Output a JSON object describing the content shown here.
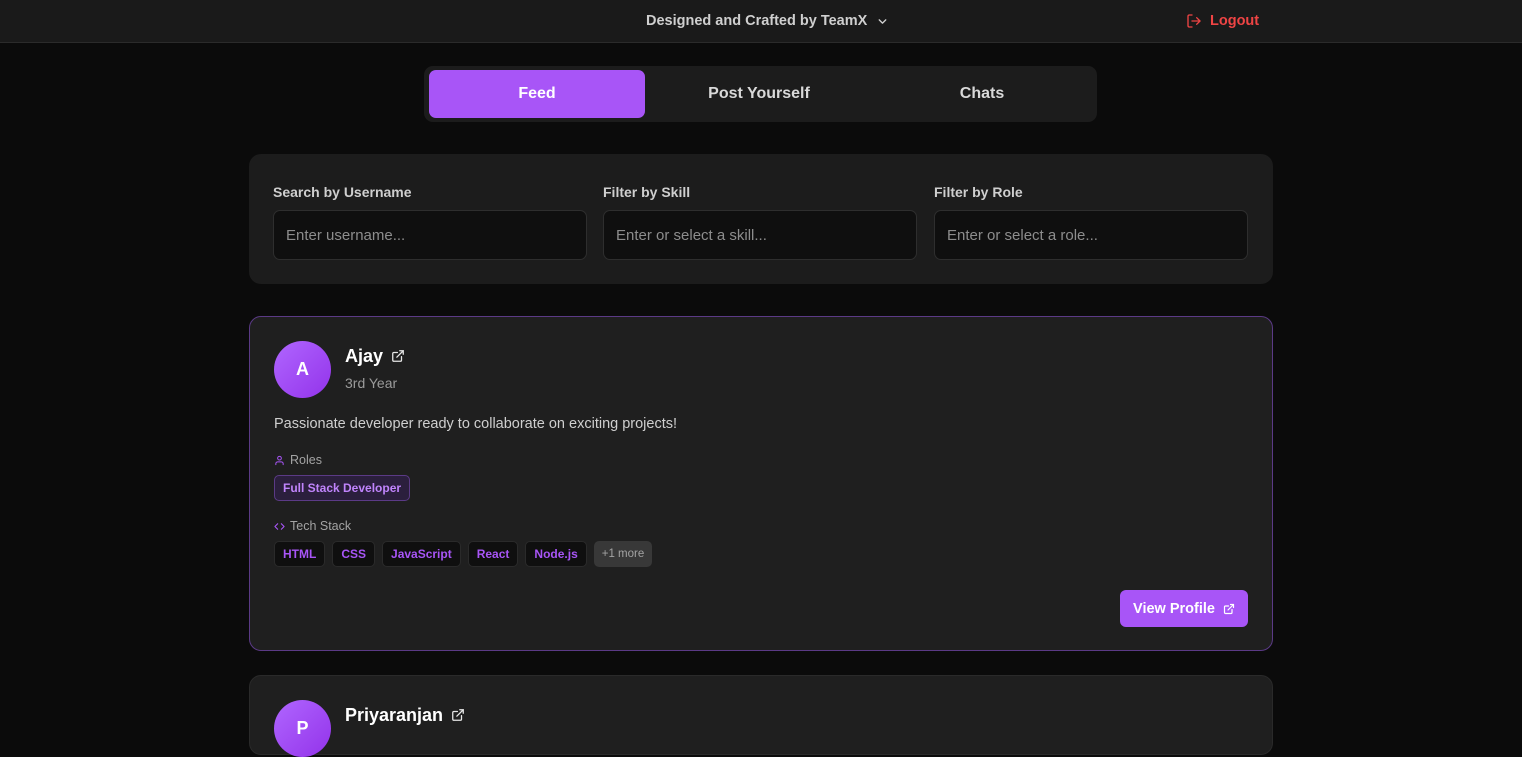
{
  "header": {
    "brand_label": "Designed and Crafted by TeamX",
    "logout_label": "Logout"
  },
  "tabs": [
    {
      "label": "Feed",
      "active": true
    },
    {
      "label": "Post Yourself",
      "active": false
    },
    {
      "label": "Chats",
      "active": false
    }
  ],
  "filters": {
    "username": {
      "label": "Search by Username",
      "placeholder": "Enter username..."
    },
    "skill": {
      "label": "Filter by Skill",
      "placeholder": "Enter or select a skill..."
    },
    "role": {
      "label": "Filter by Role",
      "placeholder": "Enter or select a role..."
    }
  },
  "profiles": [
    {
      "initial": "A",
      "name": "Ajay",
      "year": "3rd Year",
      "bio": "Passionate developer ready to collaborate on exciting projects!",
      "roles_label": "Roles",
      "roles": [
        "Full Stack Developer"
      ],
      "tech_label": "Tech Stack",
      "tech": [
        "HTML",
        "CSS",
        "JavaScript",
        "React",
        "Node.js"
      ],
      "more_label": "+1 more",
      "view_label": "View Profile"
    },
    {
      "initial": "P",
      "name": "Priyaranjan"
    }
  ],
  "colors": {
    "accent": "#a855f7",
    "logout": "#ef4444",
    "background": "#0b0b0b",
    "card": "#1f1f1f"
  }
}
